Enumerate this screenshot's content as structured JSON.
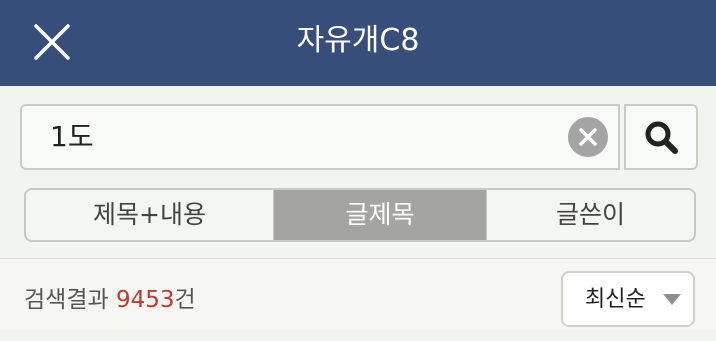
{
  "header": {
    "title": "자유개C8",
    "close_icon": "close-icon",
    "background": "#374d7a"
  },
  "search": {
    "value": "1도",
    "clear_icon": "clear-icon",
    "search_icon": "search-icon"
  },
  "tabs": [
    {
      "label": "제목+내용",
      "selected": false
    },
    {
      "label": "글제목",
      "selected": true
    },
    {
      "label": "글쓴이",
      "selected": false
    }
  ],
  "results": {
    "prefix": "검색결과 ",
    "count": "9453",
    "suffix": "건",
    "count_color": "#c0392b"
  },
  "sort": {
    "label": "최신순",
    "icon": "dropdown-arrow-icon"
  }
}
